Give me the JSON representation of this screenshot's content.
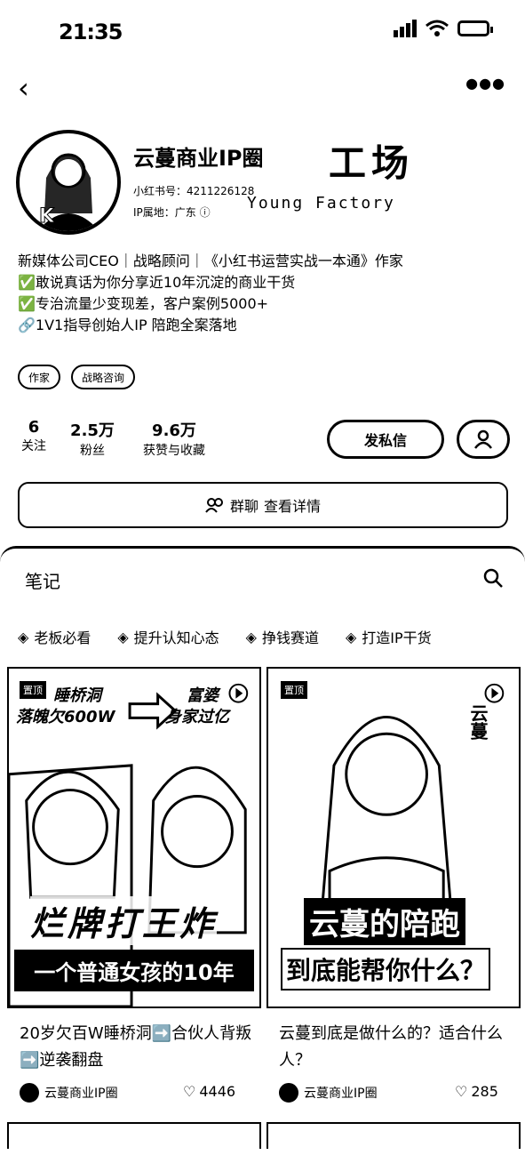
{
  "status": {
    "time": "21:35"
  },
  "profile": {
    "name": "云蔓商业IP圈",
    "brand": "工场",
    "brand_sub": "Young Factory",
    "red_id": "小红书号：4211226128",
    "ip_location": "IP属地：广东",
    "bio": [
      "新媒体公司CEO｜战略顾问｜《小红书运营实战一本通》作家",
      "✅敢说真话为你分享近10年沉淀的商业干货",
      "✅专治流量少变现差，客户案例5000+",
      "🔗1V1指导创始人IP 陪跑全案落地"
    ],
    "tags": [
      "作家",
      "战略咨询"
    ],
    "stats": [
      {
        "value": "6",
        "label": "关注"
      },
      {
        "value": "2.5万",
        "label": "粉丝"
      },
      {
        "value": "9.6万",
        "label": "获赞与收藏"
      }
    ],
    "message_button": "发私信",
    "group_chat": "群聊",
    "view_details": "查看详情"
  },
  "notes_section": {
    "tab": "笔记",
    "collections": [
      "老板必看",
      "提升认知心态",
      "挣钱赛道",
      "打造IP干货"
    ]
  },
  "cards": [
    {
      "badge": "置顶",
      "cover_top_left": "睡桥洞",
      "cover_top_left2": "落魄欠600W",
      "cover_top_right": "富婆",
      "cover_top_right2": "身家过亿",
      "cover_big": "烂牌打王炸",
      "cover_banner": "一个普通女孩的10年",
      "title": "20岁欠百W睡桥洞➡️合伙人背叛➡️逆袭翻盘",
      "author": "云蔓商业IP圈",
      "likes": "4446"
    },
    {
      "badge": "置顶",
      "cover_side": "云蔓",
      "cover_big": "云蔓的陪跑",
      "cover_banner": "到底能帮你什么？",
      "title": "云蔓到底是做什么的？适合什么人？",
      "author": "云蔓商业IP圈",
      "likes": "285"
    }
  ]
}
